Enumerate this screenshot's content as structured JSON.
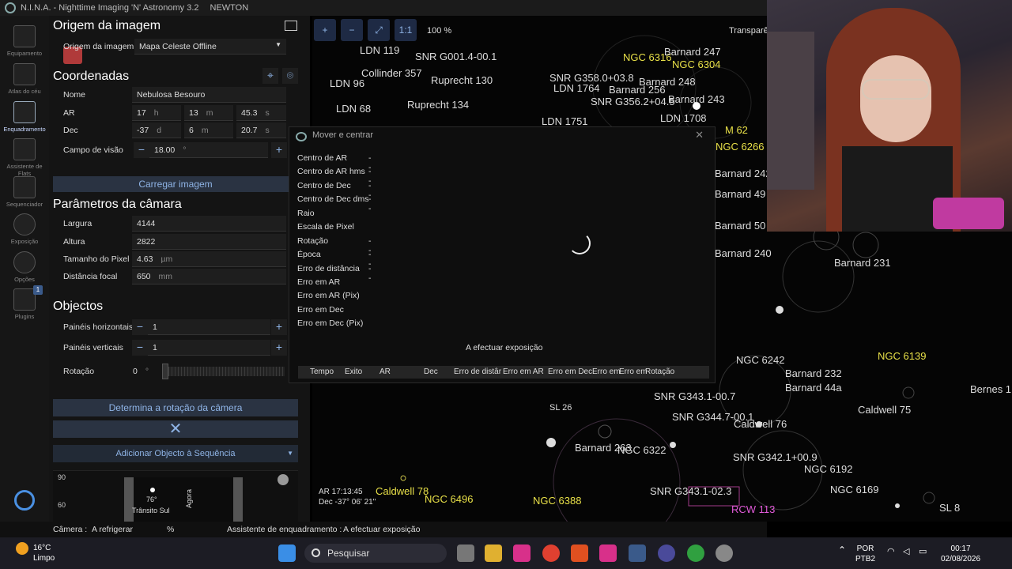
{
  "window": {
    "app_title": "N.I.N.A. - Nighttime Imaging 'N' Astronomy 3.2",
    "profile": "NEWTON"
  },
  "rail": {
    "items": [
      {
        "label": "Equipamento",
        "icon": "telescope-icon"
      },
      {
        "label": "Atlas do céu",
        "icon": "sky-atlas-icon"
      },
      {
        "label": "Enquadramento",
        "icon": "framing-icon",
        "active": true
      },
      {
        "label": "Assistente de Flats",
        "icon": "flat-wizard-icon"
      },
      {
        "label": "Sequenciador",
        "icon": "sequencer-icon"
      },
      {
        "label": "Exposição",
        "icon": "imaging-icon"
      },
      {
        "label": "Opções",
        "icon": "gear-icon"
      },
      {
        "label": "Plugins",
        "icon": "puzzle-icon",
        "badge": "1"
      }
    ],
    "collapse": "<<"
  },
  "image_source": {
    "title": "Origem da imagem",
    "label": "Origem da imagem",
    "value": "Mapa Celeste Offline"
  },
  "coordinates": {
    "title": "Coordenadas",
    "name_label": "Nome",
    "name_value": "Nebulosa Besouro",
    "ra_label": "AR",
    "ra_h": "17",
    "ra_h_unit": "h",
    "ra_m": "13",
    "ra_m_unit": "m",
    "ra_s": "45.3",
    "ra_s_unit": "s",
    "dec_label": "Dec",
    "dec_d": "-37",
    "dec_d_unit": "d",
    "dec_m": "6",
    "dec_m_unit": "m",
    "dec_s": "20.7",
    "dec_s_unit": "s",
    "fov_label": "Campo de visão",
    "fov_value": "18.00",
    "fov_unit": "°",
    "load_button": "Carregar imagem"
  },
  "camera": {
    "title": "Parâmetros da câmara",
    "width_label": "Largura",
    "width_value": "4144",
    "height_label": "Altura",
    "height_value": "2822",
    "pixel_label": "Tamanho do Pixel",
    "pixel_value": "4.63",
    "pixel_unit": "µm",
    "focal_label": "Distância focal",
    "focal_value": "650",
    "focal_unit": "mm"
  },
  "objects": {
    "title": "Objectos",
    "h_panels_label": "Painéis horizontais",
    "h_panels_value": "1",
    "v_panels_label": "Painéis verticais",
    "v_panels_value": "1",
    "rotation_label": "Rotação",
    "rotation_value": "0",
    "rotation_unit": "°",
    "determine_rotation": "Determina a rotação da câmera",
    "add_to_sequence": "Adicionar Objecto à Sequência"
  },
  "altitude_chart": {
    "ticks": [
      "90",
      "60"
    ],
    "transit_deg": "76°",
    "transit_label": "Trânsito Sul",
    "now_label": "Agora"
  },
  "status_bar": {
    "camera_label": "Câmera :",
    "camera_status": "A refrigerar",
    "percent": "%",
    "framing_label": "Assistente de enquadramento :",
    "framing_status": "A efectuar exposição"
  },
  "sky_toolbar": {
    "zoom_in": "+",
    "zoom_out": "−",
    "fit": "⤢",
    "one_to_one": "1:1",
    "zoom_level": "100 %",
    "transparency": "Transparên"
  },
  "sky_labels": [
    {
      "text": "LDN 119",
      "c": "w"
    },
    {
      "text": "SNR G001.4-00.1",
      "c": "w"
    },
    {
      "text": "NGC 6316",
      "c": "y"
    },
    {
      "text": "Barnard 247",
      "c": "w"
    },
    {
      "text": "NGC 6304",
      "c": "y"
    },
    {
      "text": "Collinder 357",
      "c": "w"
    },
    {
      "text": "Ruprecht 130",
      "c": "w"
    },
    {
      "text": "SNR G358.0+03.8",
      "c": "w"
    },
    {
      "text": "Barnard 256",
      "c": "w"
    },
    {
      "text": "SNR G356.2+04.5",
      "c": "w"
    },
    {
      "text": "Barnard 243",
      "c": "w"
    },
    {
      "text": "Ruprecht 134",
      "c": "w"
    },
    {
      "text": "LDN 1751",
      "c": "w"
    },
    {
      "text": "LDN 1708",
      "c": "w"
    },
    {
      "text": "M 62",
      "c": "y"
    },
    {
      "text": "NGC 6266",
      "c": "y"
    },
    {
      "text": "Barnard 242",
      "c": "w"
    },
    {
      "text": "Barnard 49",
      "c": "w"
    },
    {
      "text": "Barnard 50",
      "c": "w"
    },
    {
      "text": "Barnard 240",
      "c": "w"
    },
    {
      "text": "Barnard 231",
      "c": "w"
    },
    {
      "text": "NGC 6139",
      "c": "y"
    },
    {
      "text": "NGC 6242",
      "c": "w"
    },
    {
      "text": "Barnard 232",
      "c": "w"
    },
    {
      "text": "Barnard 44a",
      "c": "w"
    },
    {
      "text": "Bernes 1",
      "c": "w"
    },
    {
      "text": "Caldwell 75",
      "c": "w"
    },
    {
      "text": "Caldwell 76",
      "c": "w"
    },
    {
      "text": "SNR G343.1-00.7",
      "c": "w"
    },
    {
      "text": "SNR G344.7-00.1",
      "c": "w"
    },
    {
      "text": "Barnard 263",
      "c": "w"
    },
    {
      "text": "NGC 6322",
      "c": "w"
    },
    {
      "text": "SNR G342.1+00.9",
      "c": "w"
    },
    {
      "text": "NGC 6192",
      "c": "w"
    },
    {
      "text": "NGC 6169",
      "c": "w"
    },
    {
      "text": "SNR G343.1-02.3",
      "c": "w"
    },
    {
      "text": "Caldwell 78",
      "c": "y"
    },
    {
      "text": "NGC 6496",
      "c": "y"
    },
    {
      "text": "NGC 6388",
      "c": "y"
    },
    {
      "text": "RCW 113",
      "c": "m"
    },
    {
      "text": "SL 8",
      "c": "w"
    },
    {
      "text": "SL 26",
      "c": "w"
    },
    {
      "text": "LDN 96",
      "c": "w"
    },
    {
      "text": "LDN 68",
      "c": "w"
    },
    {
      "text": "LDN 1764",
      "c": "w"
    },
    {
      "text": "Barnard 248",
      "c": "w"
    }
  ],
  "sky_coords": {
    "ra": "AR 17:13:45",
    "dec": "Dec -37° 06' 21\""
  },
  "dialog": {
    "title": "Mover e centrar",
    "rows": [
      {
        "label": "Centro de AR",
        "value": "--"
      },
      {
        "label": "Centro de AR hms",
        "value": "--"
      },
      {
        "label": "Centro de Dec",
        "value": "--"
      },
      {
        "label": "Centro de Dec dms",
        "value": "--"
      },
      {
        "label": "Raio",
        "value": ""
      },
      {
        "label": "Escala de Pixel",
        "value": ""
      },
      {
        "label": "Rotação",
        "value": "--"
      },
      {
        "label": "Época",
        "value": "--"
      },
      {
        "label": "Erro de distância",
        "value": "--"
      },
      {
        "label": "Erro em AR",
        "value": ""
      },
      {
        "label": "Erro em AR (Pix)",
        "value": ""
      },
      {
        "label": "Erro em Dec",
        "value": ""
      },
      {
        "label": "Erro em Dec (Pix)",
        "value": ""
      }
    ],
    "status": "A efectuar exposição",
    "columns": [
      "Tempo",
      "Exito",
      "AR",
      "Dec",
      "Erro de distâr",
      "Erro em AR",
      "Erro em Dec",
      "Erro em",
      "Erro em",
      "Rotação"
    ]
  },
  "taskbar": {
    "temp": "16°C",
    "weather": "Limpo",
    "search": "Pesquisar",
    "lang1": "POR",
    "lang2": "PTB2",
    "time": "00:17",
    "date": "02/08/2026"
  }
}
